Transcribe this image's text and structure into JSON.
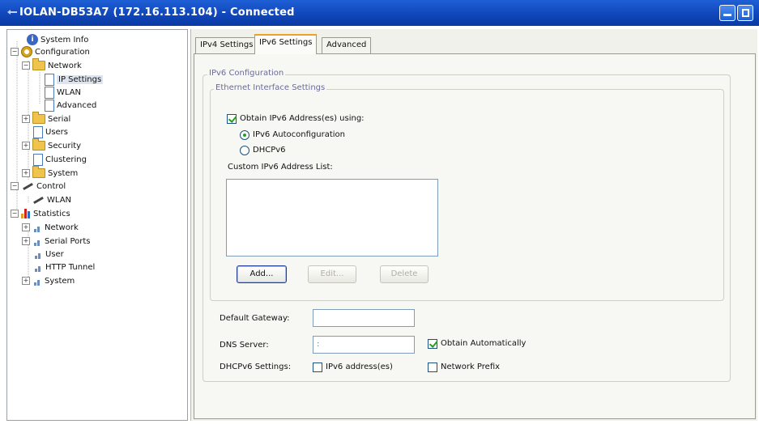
{
  "window": {
    "title": "IOLAN-DB53A7 (172.16.113.104) - Connected",
    "controls": [
      "minimize-icon",
      "restore-icon"
    ]
  },
  "tree": {
    "items": [
      {
        "label": "System Info",
        "icon": "info-icon",
        "expander": ""
      },
      {
        "label": "Configuration",
        "icon": "gear-icon",
        "expander": "−"
      },
      {
        "label": "Network",
        "icon": "folder-icon",
        "expander": "−"
      },
      {
        "label": "IP Settings",
        "icon": "document-icon",
        "expander": "",
        "selected": true
      },
      {
        "label": "WLAN",
        "icon": "document-icon",
        "expander": ""
      },
      {
        "label": "Advanced",
        "icon": "document-icon",
        "expander": ""
      },
      {
        "label": "Serial",
        "icon": "folder-icon",
        "expander": "+"
      },
      {
        "label": "Users",
        "icon": "document-icon",
        "expander": ""
      },
      {
        "label": "Security",
        "icon": "folder-icon",
        "expander": "+"
      },
      {
        "label": "Clustering",
        "icon": "document-icon",
        "expander": ""
      },
      {
        "label": "System",
        "icon": "folder-icon",
        "expander": "+"
      },
      {
        "label": "Control",
        "icon": "wrench-icon",
        "expander": "−"
      },
      {
        "label": "WLAN",
        "icon": "wrench-icon",
        "expander": ""
      },
      {
        "label": "Statistics",
        "icon": "bar-chart-icon",
        "expander": "−"
      },
      {
        "label": "Network",
        "icon": "small-bar-chart-icon",
        "expander": "+"
      },
      {
        "label": "Serial Ports",
        "icon": "small-bar-chart-icon",
        "expander": "+"
      },
      {
        "label": "User",
        "icon": "small-bar-chart-icon",
        "expander": ""
      },
      {
        "label": "HTTP Tunnel",
        "icon": "small-bar-chart-icon",
        "expander": ""
      },
      {
        "label": "System",
        "icon": "small-bar-chart-icon",
        "expander": "+"
      }
    ]
  },
  "tabs": [
    {
      "label": "IPv4 Settings",
      "active": false
    },
    {
      "label": "IPv6 Settings",
      "active": true
    },
    {
      "label": "Advanced",
      "active": false
    }
  ],
  "ipv6": {
    "group_label": "IPv6 Configuration",
    "ethernet_group_label": "Ethernet Interface Settings",
    "obtain_label": "Obtain IPv6 Address(es) using:",
    "obtain_checked": true,
    "autoconf_label": "IPv6 Autoconfiguration",
    "autoconf_selected": true,
    "dhcpv6_label": "DHCPv6",
    "dhcpv6_selected": false,
    "custom_list_label": "Custom IPv6 Address List:",
    "custom_list_items": [],
    "add_button": "Add...",
    "edit_button": "Edit...",
    "delete_button": "Delete",
    "default_gateway_label": "Default Gateway:",
    "default_gateway_value": "",
    "dns_server_label": "DNS Server:",
    "dns_server_value": ":",
    "obtain_auto_label": "Obtain Automatically",
    "obtain_auto_checked": true,
    "dhcpv6_settings_label": "DHCPv6 Settings:",
    "ipv6_addresses_label": "IPv6 address(es)",
    "ipv6_addresses_checked": false,
    "network_prefix_label": "Network Prefix",
    "network_prefix_checked": false
  }
}
